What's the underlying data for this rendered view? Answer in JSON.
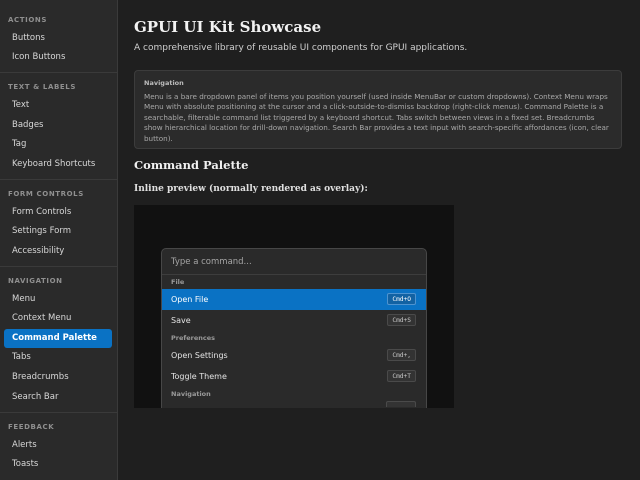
{
  "sidebar": {
    "sections": [
      {
        "title": "ACTIONS",
        "items": [
          "Buttons",
          "Icon Buttons"
        ]
      },
      {
        "title": "TEXT & LABELS",
        "items": [
          "Text",
          "Badges",
          "Tag",
          "Keyboard Shortcuts"
        ]
      },
      {
        "title": "FORM CONTROLS",
        "items": [
          "Form Controls",
          "Settings Form",
          "Accessibility"
        ]
      },
      {
        "title": "NAVIGATION",
        "items": [
          "Menu",
          "Context Menu",
          "Command Palette",
          "Tabs",
          "Breadcrumbs",
          "Search Bar"
        ]
      },
      {
        "title": "FEEDBACK",
        "items": [
          "Alerts",
          "Toasts"
        ]
      }
    ],
    "active_item": "Command Palette"
  },
  "main": {
    "title": "GPUI UI Kit Showcase",
    "subtitle": "A comprehensive library of reusable UI components for GPUI applications.",
    "info": {
      "title": "Navigation",
      "text": "Menu is a bare dropdown panel of items you position yourself (used inside MenuBar or custom dropdowns). Context Menu wraps Menu with absolute positioning at the cursor and a click-outside-to-dismiss backdrop (right-click menus). Command Palette is a searchable, filterable command list triggered by a keyboard shortcut. Tabs switch between views in a fixed set. Breadcrumbs show hierarchical location for drill-down navigation. Search Bar provides a text input with search-specific affordances (icon, clear button)."
    },
    "section_heading": "Command Palette",
    "preview_label": "Inline preview (normally rendered as overlay):"
  },
  "palette": {
    "placeholder": "Type a command...",
    "groups": [
      {
        "label": "File",
        "commands": [
          {
            "label": "Open File",
            "shortcut": "Cmd+O",
            "selected": true
          },
          {
            "label": "Save",
            "shortcut": "Cmd+S",
            "selected": false
          }
        ]
      },
      {
        "label": "Preferences",
        "commands": [
          {
            "label": "Open Settings",
            "shortcut": "Cmd+,",
            "selected": false
          },
          {
            "label": "Toggle Theme",
            "shortcut": "Cmd+T",
            "selected": false
          }
        ]
      },
      {
        "label": "Navigation",
        "commands": []
      }
    ]
  },
  "colors": {
    "accent": "#0a72c4",
    "sidebar_bg": "#2a2a2a",
    "main_bg": "#1f1f1f",
    "preview_bg": "#111111"
  }
}
